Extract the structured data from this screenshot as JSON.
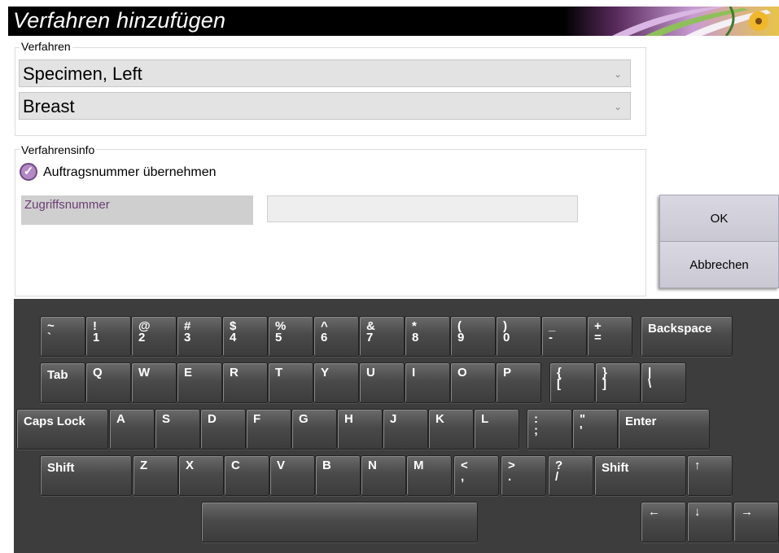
{
  "dialog": {
    "title": "Verfahren hinzufügen"
  },
  "procedure": {
    "legend": "Verfahren",
    "procedure_value": "Specimen, Left",
    "body_part_value": "Breast",
    "chevron": "chevron-down-icon"
  },
  "procedure_info": {
    "legend": "Verfahrensinfo",
    "use_order_number_label": "Auftragsnummer übernehmen",
    "use_order_number_checked": true,
    "accession_label": "Zugriffsnummer",
    "accession_value": ""
  },
  "buttons": {
    "ok": "OK",
    "cancel": "Abbrechen"
  },
  "keyboard": {
    "row1": [
      {
        "top": "~",
        "bot": "`"
      },
      {
        "top": "!",
        "bot": "1"
      },
      {
        "top": "@",
        "bot": "2"
      },
      {
        "top": "#",
        "bot": "3"
      },
      {
        "top": "$",
        "bot": "4"
      },
      {
        "top": "%",
        "bot": "5"
      },
      {
        "top": "^",
        "bot": "6"
      },
      {
        "top": "&",
        "bot": "7"
      },
      {
        "top": "*",
        "bot": "8"
      },
      {
        "top": "(",
        "bot": "9"
      },
      {
        "top": ")",
        "bot": "0"
      },
      {
        "top": "_",
        "bot": "-"
      },
      {
        "top": "+",
        "bot": "="
      },
      {
        "label": "Backspace"
      }
    ],
    "row2": [
      {
        "label": "Tab"
      },
      {
        "label": "Q"
      },
      {
        "label": "W"
      },
      {
        "label": "E"
      },
      {
        "label": "R"
      },
      {
        "label": "T"
      },
      {
        "label": "Y"
      },
      {
        "label": "U"
      },
      {
        "label": "I"
      },
      {
        "label": "O"
      },
      {
        "label": "P"
      },
      {
        "top": "{",
        "bot": "["
      },
      {
        "top": "}",
        "bot": "]"
      },
      {
        "top": "|",
        "bot": "\\"
      }
    ],
    "row3": [
      {
        "label": "Caps Lock"
      },
      {
        "label": "A"
      },
      {
        "label": "S"
      },
      {
        "label": "D"
      },
      {
        "label": "F"
      },
      {
        "label": "G"
      },
      {
        "label": "H"
      },
      {
        "label": "J"
      },
      {
        "label": "K"
      },
      {
        "label": "L"
      },
      {
        "top": ":",
        "bot": ";"
      },
      {
        "top": "\"",
        "bot": "'"
      },
      {
        "label": "Enter"
      }
    ],
    "row4": [
      {
        "label": "Shift"
      },
      {
        "label": "Z"
      },
      {
        "label": "X"
      },
      {
        "label": "C"
      },
      {
        "label": "V"
      },
      {
        "label": "B"
      },
      {
        "label": "N"
      },
      {
        "label": "M"
      },
      {
        "top": "<",
        "bot": ","
      },
      {
        "top": ">",
        "bot": "."
      },
      {
        "top": "?",
        "bot": "/"
      },
      {
        "label": "Shift"
      },
      {
        "label": "↑"
      }
    ],
    "row5": [
      {
        "label": ""
      },
      {
        "label": "←"
      },
      {
        "label": "↓"
      },
      {
        "label": "→"
      }
    ]
  }
}
